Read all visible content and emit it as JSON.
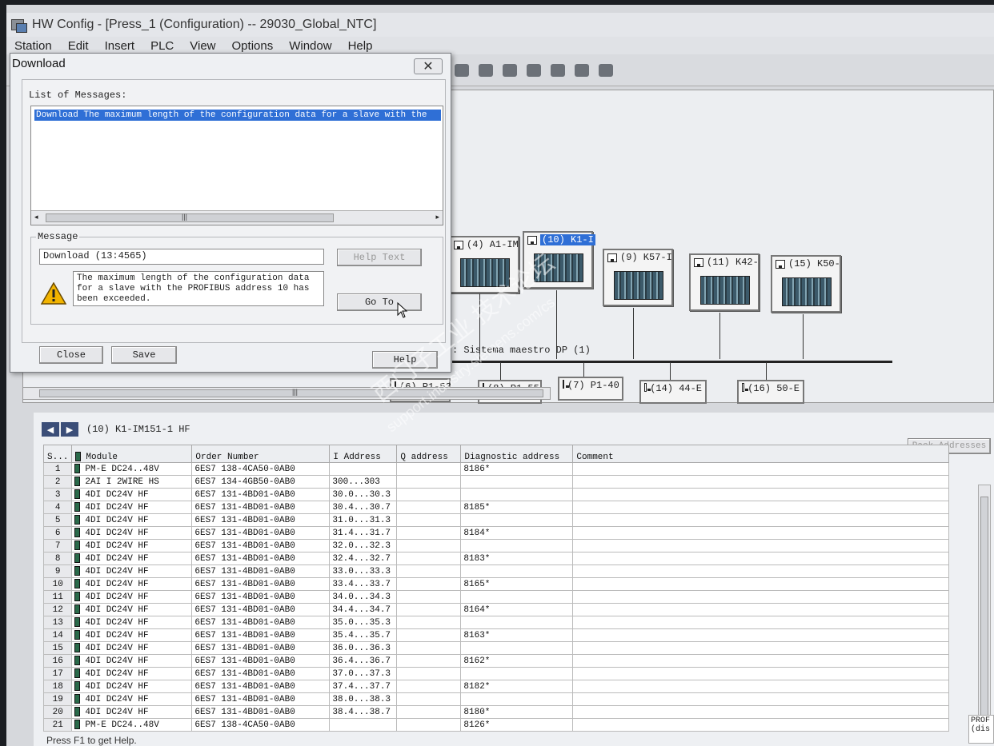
{
  "window": {
    "title": "HW Config - [Press_1 (Configuration) -- 29030_Global_NTC]",
    "status": "Press F1 to get Help."
  },
  "menu": [
    "Station",
    "Edit",
    "Insert",
    "PLC",
    "View",
    "Options",
    "Window",
    "Help"
  ],
  "station": {
    "nodes": [
      {
        "label": "(4) A1-IM",
        "selected": false
      },
      {
        "label": "(10) K1-I",
        "selected": true
      },
      {
        "label": "(9) K57-I",
        "selected": false
      },
      {
        "label": "(11) K42-",
        "selected": false
      },
      {
        "label": "(15) K50-",
        "selected": false
      }
    ],
    "bus_label": ": Sistema maestro DP (1)",
    "sub_nodes": [
      "(6) P1-53",
      "(8) P1-55",
      "(7) P1-40",
      "(14) 44-E",
      "(16) 50-E"
    ]
  },
  "dialog": {
    "title": "Download",
    "close_symbol": "✕",
    "list_label": "List of Messages:",
    "list_rows": [
      "Download The maximum length of the configuration data for a slave with the"
    ],
    "message_group": "Message",
    "message_code": "Download (13:4565)",
    "message_text": "The maximum length of the configuration data for a slave with the PROFIBUS address 10 has been exceeded.",
    "buttons": {
      "help_text": "Help Text",
      "go_to": "Go To",
      "close": "Close",
      "save": "Save",
      "help": "Help"
    }
  },
  "modules": {
    "slot_title": "(10)   K1-IM151-1 HF",
    "pack_button": "Pack Addresses",
    "columns": [
      "S...",
      "Module",
      "Order Number",
      "I Address",
      "Q address",
      "Diagnostic address",
      "Comment"
    ],
    "rows": [
      {
        "slot": "1",
        "module": "PM-E DC24..48V",
        "order": "6ES7 138-4CA50-0AB0",
        "i": "",
        "q": "",
        "diag": "8186*"
      },
      {
        "slot": "2",
        "module": "2AI I 2WIRE HS",
        "order": "6ES7 134-4GB50-0AB0",
        "i": "300...303",
        "q": "",
        "diag": ""
      },
      {
        "slot": "3",
        "module": "4DI DC24V HF",
        "order": "6ES7 131-4BD01-0AB0",
        "i": "30.0...30.3",
        "q": "",
        "diag": ""
      },
      {
        "slot": "4",
        "module": "4DI DC24V HF",
        "order": "6ES7 131-4BD01-0AB0",
        "i": "30.4...30.7",
        "q": "",
        "diag": "8185*"
      },
      {
        "slot": "5",
        "module": "4DI DC24V HF",
        "order": "6ES7 131-4BD01-0AB0",
        "i": "31.0...31.3",
        "q": "",
        "diag": ""
      },
      {
        "slot": "6",
        "module": "4DI DC24V HF",
        "order": "6ES7 131-4BD01-0AB0",
        "i": "31.4...31.7",
        "q": "",
        "diag": "8184*"
      },
      {
        "slot": "7",
        "module": "4DI DC24V HF",
        "order": "6ES7 131-4BD01-0AB0",
        "i": "32.0...32.3",
        "q": "",
        "diag": ""
      },
      {
        "slot": "8",
        "module": "4DI DC24V HF",
        "order": "6ES7 131-4BD01-0AB0",
        "i": "32.4...32.7",
        "q": "",
        "diag": "8183*"
      },
      {
        "slot": "9",
        "module": "4DI DC24V HF",
        "order": "6ES7 131-4BD01-0AB0",
        "i": "33.0...33.3",
        "q": "",
        "diag": ""
      },
      {
        "slot": "10",
        "module": "4DI DC24V HF",
        "order": "6ES7 131-4BD01-0AB0",
        "i": "33.4...33.7",
        "q": "",
        "diag": "8165*"
      },
      {
        "slot": "11",
        "module": "4DI DC24V HF",
        "order": "6ES7 131-4BD01-0AB0",
        "i": "34.0...34.3",
        "q": "",
        "diag": ""
      },
      {
        "slot": "12",
        "module": "4DI DC24V HF",
        "order": "6ES7 131-4BD01-0AB0",
        "i": "34.4...34.7",
        "q": "",
        "diag": "8164*"
      },
      {
        "slot": "13",
        "module": "4DI DC24V HF",
        "order": "6ES7 131-4BD01-0AB0",
        "i": "35.0...35.3",
        "q": "",
        "diag": ""
      },
      {
        "slot": "14",
        "module": "4DI DC24V HF",
        "order": "6ES7 131-4BD01-0AB0",
        "i": "35.4...35.7",
        "q": "",
        "diag": "8163*"
      },
      {
        "slot": "15",
        "module": "4DI DC24V HF",
        "order": "6ES7 131-4BD01-0AB0",
        "i": "36.0...36.3",
        "q": "",
        "diag": ""
      },
      {
        "slot": "16",
        "module": "4DI DC24V HF",
        "order": "6ES7 131-4BD01-0AB0",
        "i": "36.4...36.7",
        "q": "",
        "diag": "8162*"
      },
      {
        "slot": "17",
        "module": "4DI DC24V HF",
        "order": "6ES7 131-4BD01-0AB0",
        "i": "37.0...37.3",
        "q": "",
        "diag": ""
      },
      {
        "slot": "18",
        "module": "4DI DC24V HF",
        "order": "6ES7 131-4BD01-0AB0",
        "i": "37.4...37.7",
        "q": "",
        "diag": "8182*"
      },
      {
        "slot": "19",
        "module": "4DI DC24V HF",
        "order": "6ES7 131-4BD01-0AB0",
        "i": "38.0...38.3",
        "q": "",
        "diag": ""
      },
      {
        "slot": "20",
        "module": "4DI DC24V HF",
        "order": "6ES7 131-4BD01-0AB0",
        "i": "38.4...38.7",
        "q": "",
        "diag": "8180*"
      },
      {
        "slot": "21",
        "module": "PM-E DC24..48V",
        "order": "6ES7 138-4CA50-0AB0",
        "i": "",
        "q": "",
        "diag": "8126*"
      }
    ],
    "side_text": "PROF (dis"
  },
  "watermark": {
    "line1": "西门子工业 技术论坛",
    "line2": "support.industry.siemens.com/cs"
  }
}
